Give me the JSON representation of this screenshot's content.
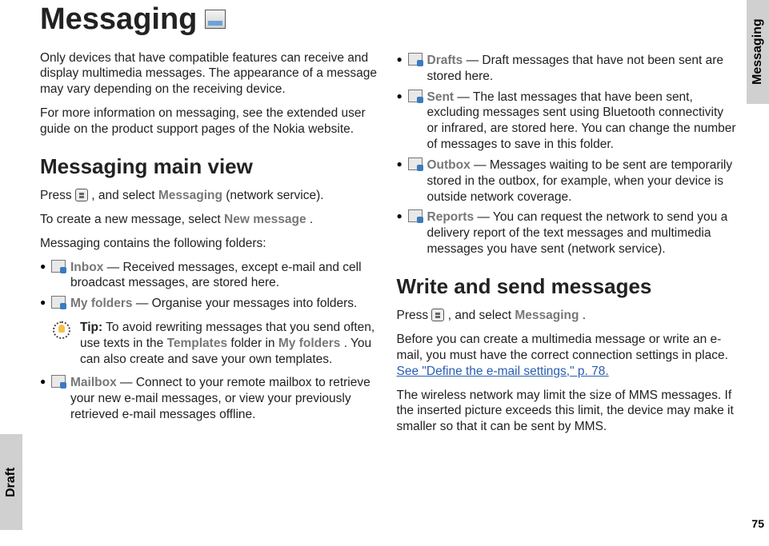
{
  "sideTabs": {
    "left": "Draft",
    "right": "Messaging"
  },
  "pageNumber": "75",
  "h1": "Messaging",
  "intro1": "Only devices that have compatible features can receive and display multimedia messages. The appearance of a message may vary depending on the receiving device.",
  "intro2": "For more information on messaging, see the extended user guide on the product support pages of the Nokia website.",
  "h2a": "Messaging main view",
  "press1a": "Press ",
  "press1b": " , and select ",
  "press1Messaging": "Messaging",
  "press1c": " (network service).",
  "createMsg1": "To create a new message, select ",
  "createMsgBold": "New message",
  "createMsg2": ".",
  "foldersIntro": "Messaging contains the following folders:",
  "inboxLabel": "Inbox",
  "inboxDesc": " — Received messages, except e-mail and cell broadcast messages, are stored here.",
  "myFoldersLabel": "My folders",
  "myFoldersDesc": "  — Organise your messages into folders.",
  "tipLabel": "Tip:",
  "tipText1": " To avoid rewriting messages that you send often, use texts in the ",
  "tipTemplates": "Templates",
  "tipText2": " folder in ",
  "tipMyFolders": "My folders",
  "tipText3": ". You can also create and save your own templates.",
  "mailboxLabel": "Mailbox",
  "mailboxDesc": " — Connect to your remote mailbox to retrieve your new e-mail messages, or view your previously retrieved e-mail messages offline.",
  "draftsLabel": "Drafts",
  "draftsDesc": " — Draft messages that have not been sent are stored here.",
  "sentLabel": "Sent",
  "sentDesc": " — The last messages that have been sent, excluding messages sent using Bluetooth connectivity or infrared, are stored here. You can change the number of messages to save in this folder.",
  "outboxLabel": "Outbox",
  "outboxDesc": " — Messages waiting to be sent are temporarily stored in the outbox, for example, when your device is outside network coverage.",
  "reportsLabel": "Reports",
  "reportsDesc": " — You can request the network to send you a delivery report of the text messages and multimedia messages you have sent (network service).",
  "h2b": "Write and send messages",
  "press2a": "Press ",
  "press2b": " , and select ",
  "press2Messaging": "Messaging",
  "press2c": ".",
  "writeIntro1": "Before you can create a multimedia message or write an e-mail, you must have the correct connection settings in place. ",
  "linkText": "See \"Define the e-mail settings,\" p. 78.",
  "mmsLimit": "The wireless network may limit the size of MMS messages. If the inserted picture exceeds this limit, the device may make it smaller so that it can be sent by MMS."
}
